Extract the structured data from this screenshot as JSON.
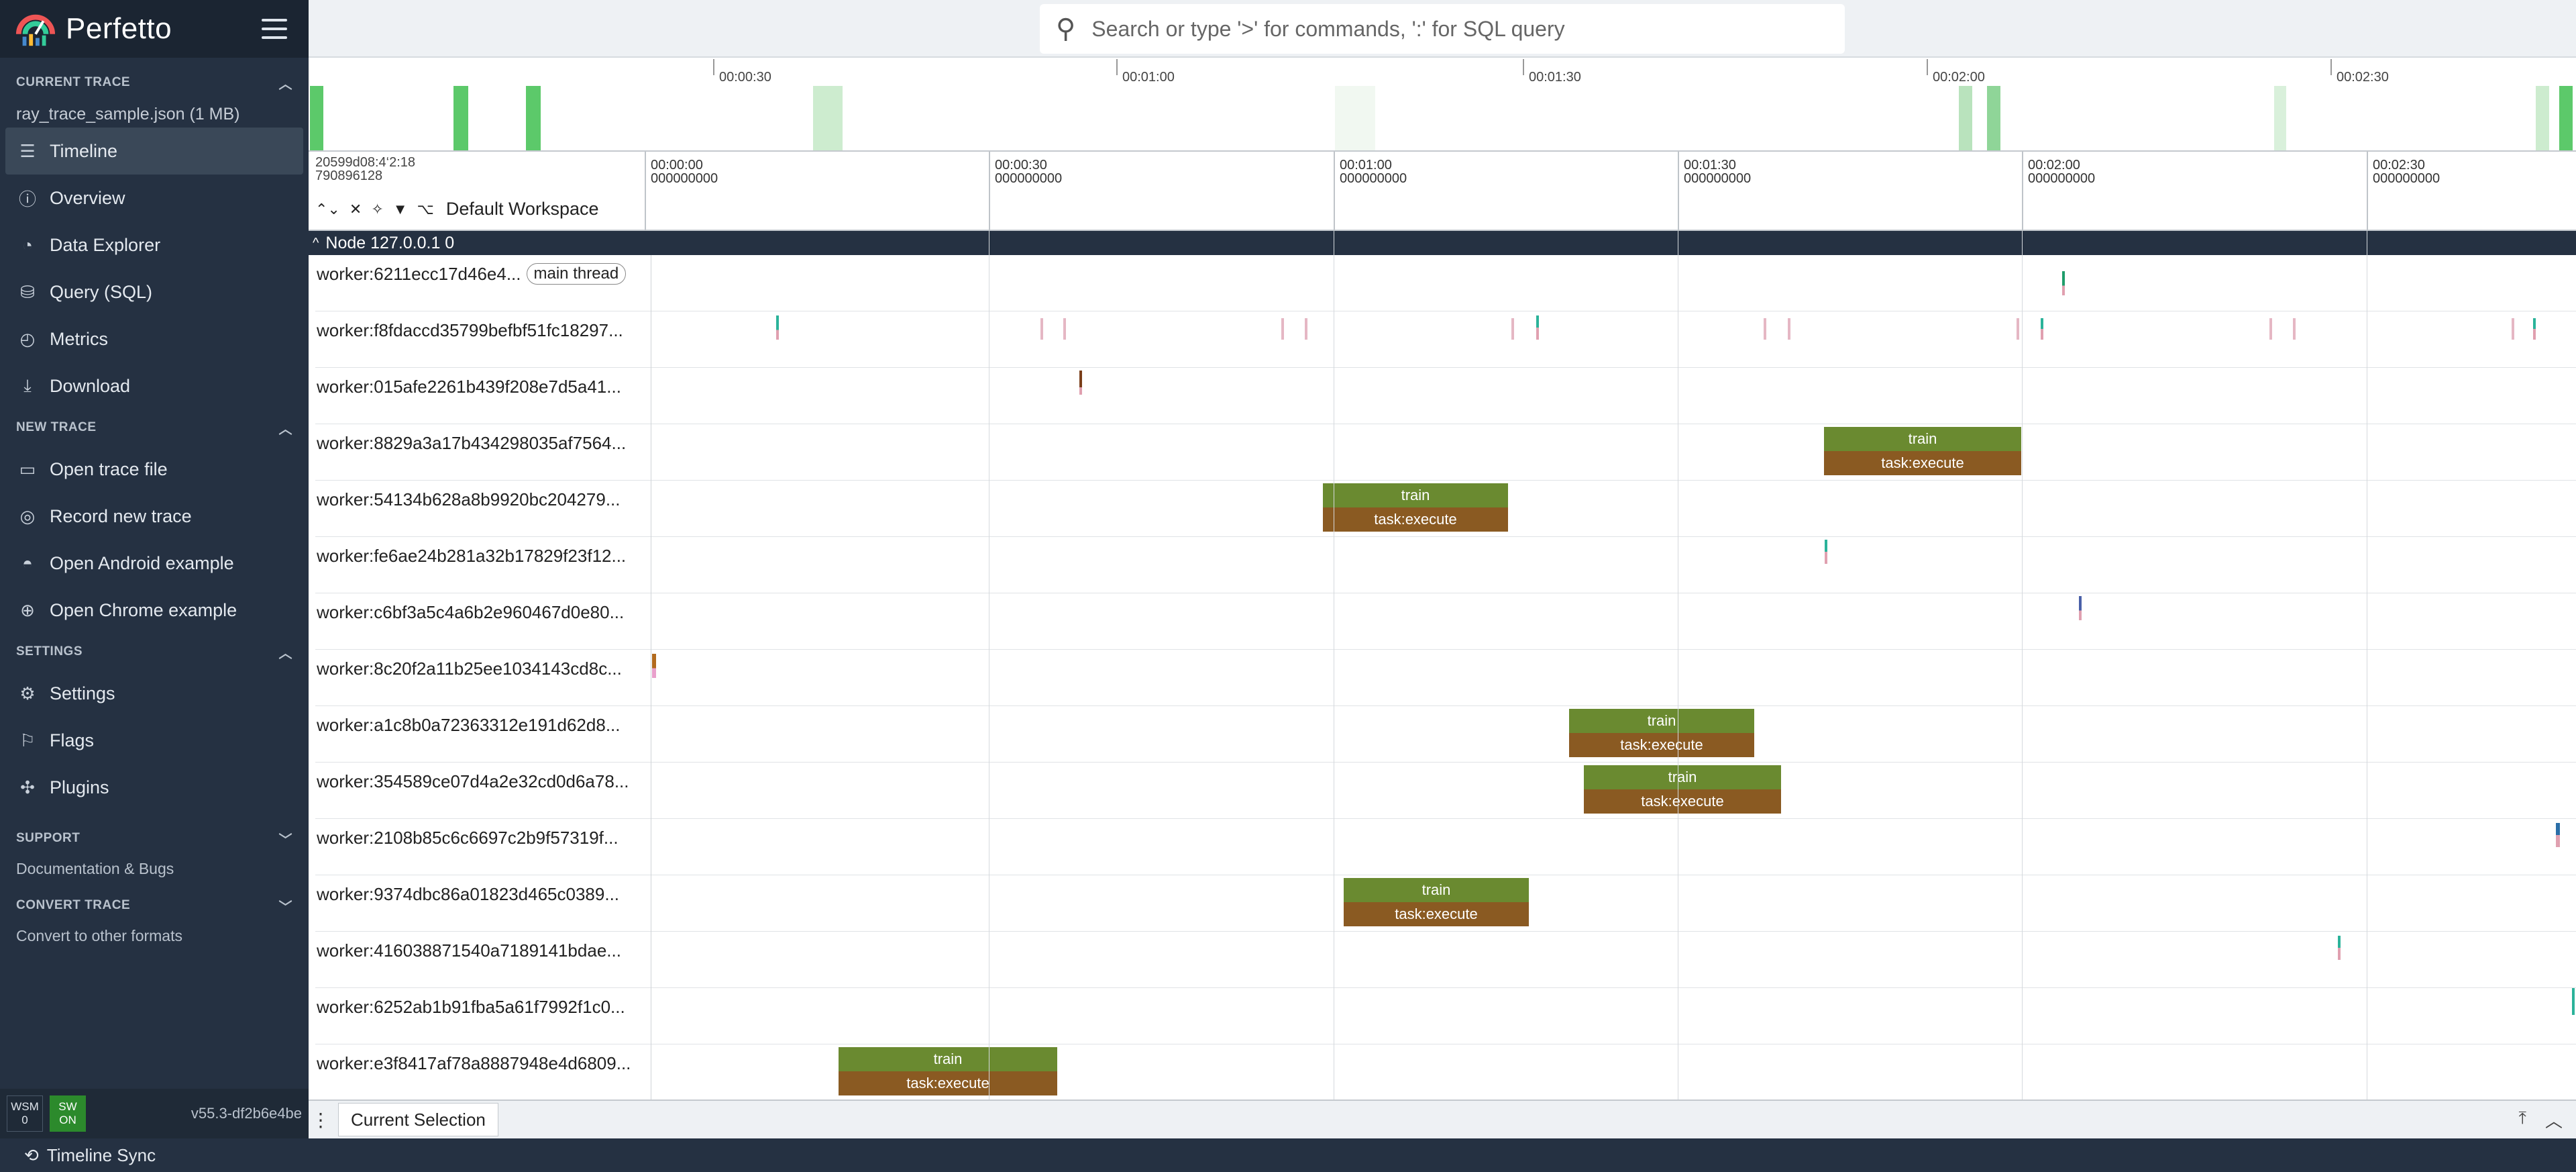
{
  "app": {
    "name": "Perfetto"
  },
  "sidebar": {
    "sections": {
      "current_trace": {
        "title": "CURRENT TRACE",
        "file": "ray_trace_sample.json (1 MB)"
      },
      "new_trace": {
        "title": "NEW TRACE"
      },
      "settings": {
        "title": "SETTINGS"
      },
      "support": {
        "title": "SUPPORT",
        "sub": "Documentation & Bugs"
      },
      "convert": {
        "title": "CONVERT TRACE",
        "sub": "Convert to other formats"
      }
    },
    "items": [
      {
        "label": "Timeline",
        "icon": "timeline-icon"
      },
      {
        "label": "Overview",
        "icon": "info-icon"
      },
      {
        "label": "Data Explorer",
        "icon": "explore-icon"
      },
      {
        "label": "Query (SQL)",
        "icon": "database-icon"
      },
      {
        "label": "Metrics",
        "icon": "speed-icon"
      },
      {
        "label": "Download",
        "icon": "download-icon"
      },
      {
        "label": "Open trace file",
        "icon": "folder-open-icon"
      },
      {
        "label": "Record new trace",
        "icon": "record-icon"
      },
      {
        "label": "Open Android example",
        "icon": "android-icon"
      },
      {
        "label": "Open Chrome example",
        "icon": "language-icon"
      },
      {
        "label": "Settings",
        "icon": "gear-icon"
      },
      {
        "label": "Flags",
        "icon": "flag-icon"
      },
      {
        "label": "Plugins",
        "icon": "extension-icon"
      }
    ],
    "footer": {
      "wsm": "WSM",
      "wsm_val": "0",
      "sw": "SW",
      "sw_val": "ON",
      "version": "v55.3-df2b6e4be"
    }
  },
  "search": {
    "placeholder": "Search or type '>' for commands, ':' for SQL query"
  },
  "overview": {
    "ticks": [
      "00:00:30",
      "00:01:00",
      "00:01:30",
      "00:02:00",
      "00:02:30"
    ]
  },
  "ruler": {
    "timestamp_line1": "20599d08:4‘2:18",
    "timestamp_line2": "790896128",
    "ticks": [
      {
        "t": "00:00:00",
        "ns": "000000000"
      },
      {
        "t": "00:00:30",
        "ns": "000000000"
      },
      {
        "t": "00:01:00",
        "ns": "000000000"
      },
      {
        "t": "00:01:30",
        "ns": "000000000"
      },
      {
        "t": "00:02:00",
        "ns": "000000000"
      },
      {
        "t": "00:02:30",
        "ns": "000000000"
      }
    ],
    "workspace": "Default Workspace"
  },
  "node": {
    "label": "Node 127.0.0.1 0"
  },
  "tracks": [
    {
      "name": "worker:6211ecc17d46e4...",
      "chip": "main thread"
    },
    {
      "name": "worker:f8fdaccd35799befbf51fc18297..."
    },
    {
      "name": "worker:015afe2261b439f208e7d5a41..."
    },
    {
      "name": "worker:8829a3a17b434298035af7564..."
    },
    {
      "name": "worker:54134b628a8b9920bc204279..."
    },
    {
      "name": "worker:fe6ae24b281a32b17829f23f12..."
    },
    {
      "name": "worker:c6bf3a5c4a6b2e960467d0e80..."
    },
    {
      "name": "worker:8c20f2a11b25ee1034143cd8c..."
    },
    {
      "name": "worker:a1c8b0a72363312e191d62d8..."
    },
    {
      "name": "worker:354589ce07d4a2e32cd0d6a78..."
    },
    {
      "name": "worker:2108b85c6c6697c2b9f57319f..."
    },
    {
      "name": "worker:9374dbc86a01823d465c0389..."
    },
    {
      "name": "worker:416038871540a7189141bdae..."
    },
    {
      "name": "worker:6252ab1b91fba5a61f7992f1c0..."
    },
    {
      "name": "worker:e3f8417af78a8887948e4d6809..."
    }
  ],
  "slices": {
    "top": "train",
    "bottom": "task:execute"
  },
  "panel": {
    "tab": "Current Selection"
  },
  "statusbar": {
    "label": "Timeline Sync"
  }
}
